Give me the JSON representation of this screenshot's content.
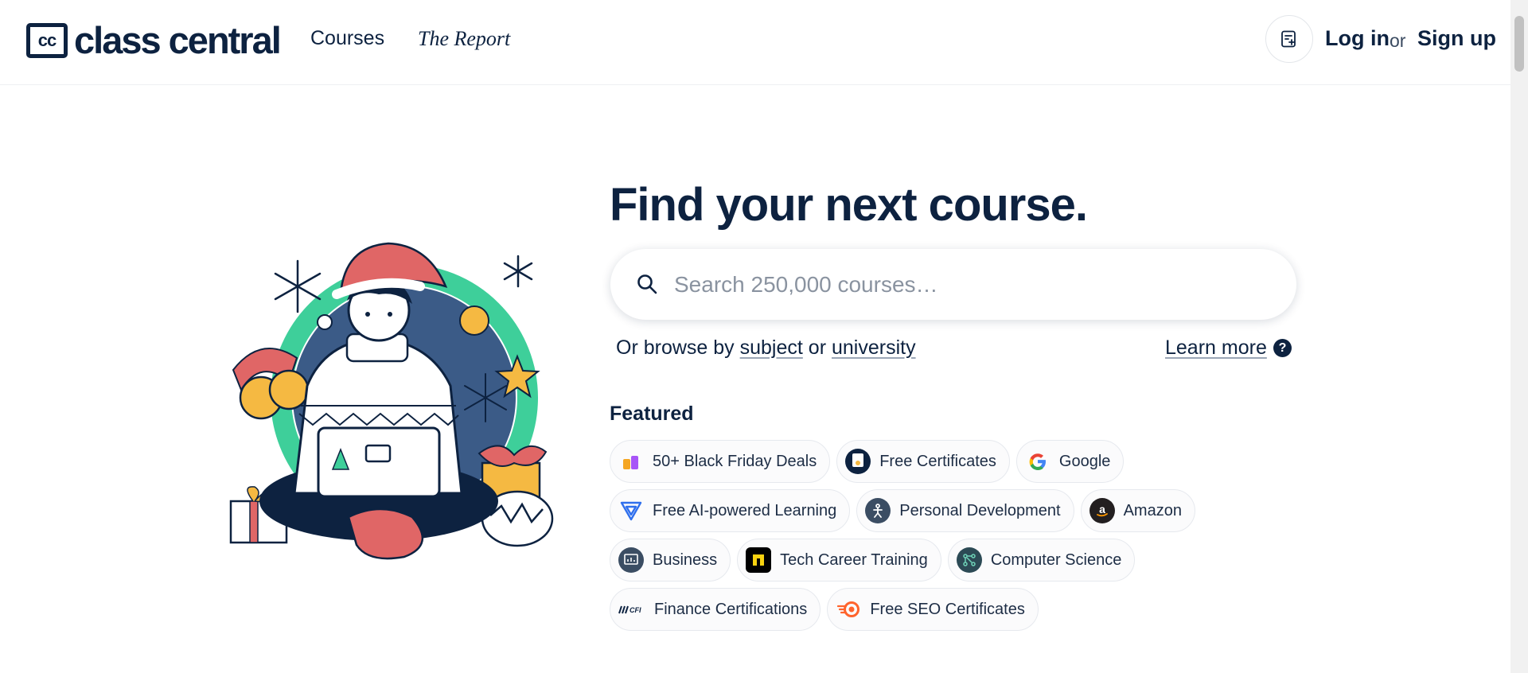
{
  "header": {
    "logo_box": "cc",
    "logo_text": "class central",
    "nav": {
      "courses": "Courses",
      "report": "The Report"
    },
    "login": "Log in",
    "or": "or",
    "signup": "Sign up"
  },
  "hero": {
    "title": "Find your next course.",
    "search_placeholder": "Search 250,000 courses…",
    "browse_prefix": "Or browse by",
    "browse_subject": "subject",
    "browse_or": "or",
    "browse_university": "university",
    "learn_more": "Learn more",
    "help_glyph": "?"
  },
  "featured": {
    "title": "Featured",
    "rows": [
      [
        {
          "label": "50+ Black Friday Deals",
          "icon": "tags-icon"
        },
        {
          "label": "Free Certificates",
          "icon": "certificate-icon"
        },
        {
          "label": "Google",
          "icon": "google-icon"
        }
      ],
      [
        {
          "label": "Free AI-powered Learning",
          "icon": "ai-learning-icon"
        },
        {
          "label": "Personal Development",
          "icon": "personal-development-icon"
        },
        {
          "label": "Amazon",
          "icon": "amazon-icon"
        }
      ],
      [
        {
          "label": "Business",
          "icon": "business-icon"
        },
        {
          "label": "Tech Career Training",
          "icon": "tech-career-icon"
        },
        {
          "label": "Computer Science",
          "icon": "computer-science-icon"
        }
      ],
      [
        {
          "label": "Finance Certifications",
          "icon": "cfi-icon"
        },
        {
          "label": "Free SEO Certificates",
          "icon": "seo-icon"
        }
      ]
    ]
  },
  "colors": {
    "navy": "#0d2240",
    "santa_red": "#e06666",
    "wreath_green": "#3ecf9a",
    "bell_gold": "#f5b942"
  }
}
